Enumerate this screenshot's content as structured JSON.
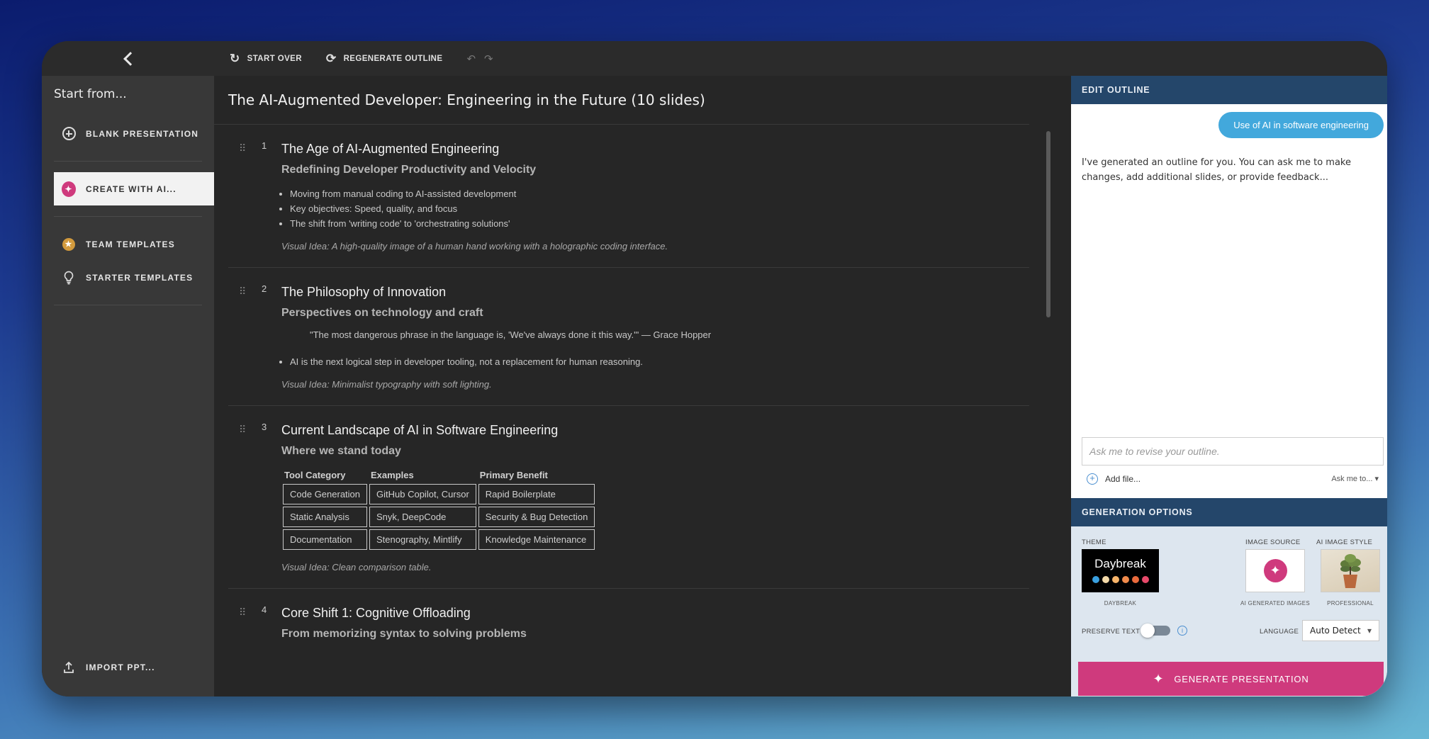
{
  "toolbar": {
    "start_over": "START OVER",
    "regenerate": "REGENERATE OUTLINE"
  },
  "sidebar": {
    "heading": "Start from...",
    "items": [
      {
        "label": "BLANK PRESENTATION",
        "icon": "plus-circle-icon"
      },
      {
        "label": "CREATE WITH AI...",
        "icon": "ai-sparkle-icon"
      },
      {
        "label": "TEAM TEMPLATES",
        "icon": "star-icon"
      },
      {
        "label": "STARTER TEMPLATES",
        "icon": "lightbulb-icon"
      }
    ],
    "import_label": "IMPORT PPT..."
  },
  "outline": {
    "title": "The AI-Augmented Developer: Engineering in the Future (10 slides)",
    "slides": [
      {
        "num": "1",
        "title": "The Age of AI-Augmented Engineering",
        "subtitle": "Redefining Developer Productivity and Velocity",
        "bullets": [
          "Moving from manual coding to AI-assisted development",
          "Key objectives: Speed, quality, and focus",
          "The shift from 'writing code' to 'orchestrating solutions'"
        ],
        "visual": "Visual Idea: A high-quality image of a human hand working with a holographic coding interface."
      },
      {
        "num": "2",
        "title": "The Philosophy of Innovation",
        "subtitle": "Perspectives on technology and craft",
        "quote": "\"The most dangerous phrase in the language is, 'We've always done it this way.'\" — Grace Hopper",
        "bullets": [
          "AI is the next logical step in developer tooling, not a replacement for human reasoning."
        ],
        "visual": "Visual Idea: Minimalist typography with soft lighting."
      },
      {
        "num": "3",
        "title": "Current Landscape of AI in Software Engineering",
        "subtitle": "Where we stand today",
        "table": {
          "headers": [
            "Tool Category",
            "Examples",
            "Primary Benefit"
          ],
          "rows": [
            [
              "Code Generation",
              "GitHub Copilot, Cursor",
              "Rapid Boilerplate"
            ],
            [
              "Static Analysis",
              "Snyk, DeepCode",
              "Security & Bug Detection"
            ],
            [
              "Documentation",
              "Stenography, Mintlify",
              "Knowledge Maintenance"
            ]
          ]
        },
        "visual": "Visual Idea: Clean comparison table."
      },
      {
        "num": "4",
        "title": "Core Shift 1: Cognitive Offloading",
        "subtitle": "From memorizing syntax to solving problems"
      }
    ]
  },
  "panel": {
    "edit_heading": "EDIT OUTLINE",
    "chip": "Use of AI in software engineering",
    "message": "I've generated an outline for you. You can ask me to make changes, add additional slides, or provide feedback...",
    "input_placeholder": "Ask me to revise your outline.",
    "add_file": "Add file...",
    "ask_to": "Ask me to...",
    "gen_heading": "GENERATION OPTIONS",
    "theme_label": "THEME",
    "theme_name": "Daybreak",
    "theme_caption": "DAYBREAK",
    "theme_colors": [
      "#3aa0e0",
      "#f3d9a8",
      "#f7b46a",
      "#f08a4b",
      "#ea6a3c",
      "#e84a6a"
    ],
    "image_source_label": "IMAGE SOURCE",
    "image_source_caption": "AI GENERATED IMAGES",
    "image_style_label": "AI IMAGE STYLE",
    "image_style_caption": "PROFESSIONAL",
    "preserve_text": "PRESERVE TEXT",
    "preserve_text_on": false,
    "language_label": "LANGUAGE",
    "language_value": "Auto Detect",
    "generate_button": "GENERATE PRESENTATION"
  }
}
